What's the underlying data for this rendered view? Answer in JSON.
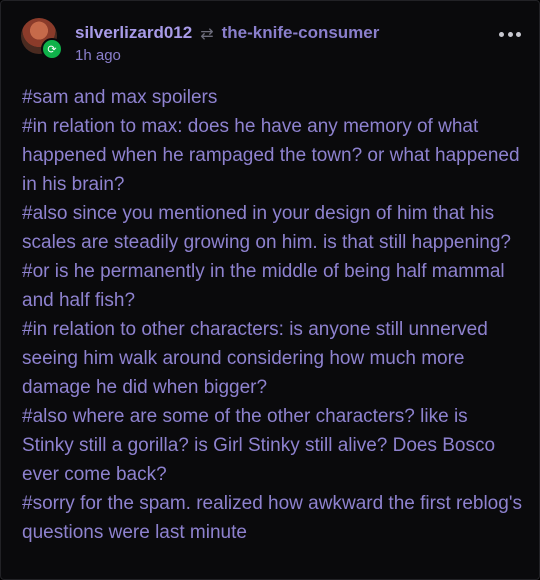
{
  "post": {
    "username": "silverlizard012",
    "reblogged_from": "the-knife-consumer",
    "timestamp": "1h ago",
    "icons": {
      "reblog": "reblog-icon",
      "reblog_badge": "reblog-badge-icon",
      "more": "more-options-icon"
    },
    "colors": {
      "background": "#0a0a0c",
      "username": "#a89be8",
      "tag_text": "#8e82cf",
      "badge": "#0fb24a"
    },
    "tags": [
      "#sam and max spoilers",
      "#in relation to max: does he have any memory of what happened when he rampaged the town? or what happened in his brain?",
      "#also since you mentioned in your design of him that his scales are steadily growing on him. is that still happening?",
      "#or is he permanently in the middle of being half mammal and half fish?",
      "#in relation to other characters: is anyone still unnerved seeing him walk around considering how much more damage he did when bigger?",
      "#also where are some of the other characters? like is Stinky still a gorilla? is Girl Stinky still alive? Does Bosco ever come back?",
      "#sorry for the spam. realized how awkward the first reblog's questions were last minute"
    ]
  }
}
